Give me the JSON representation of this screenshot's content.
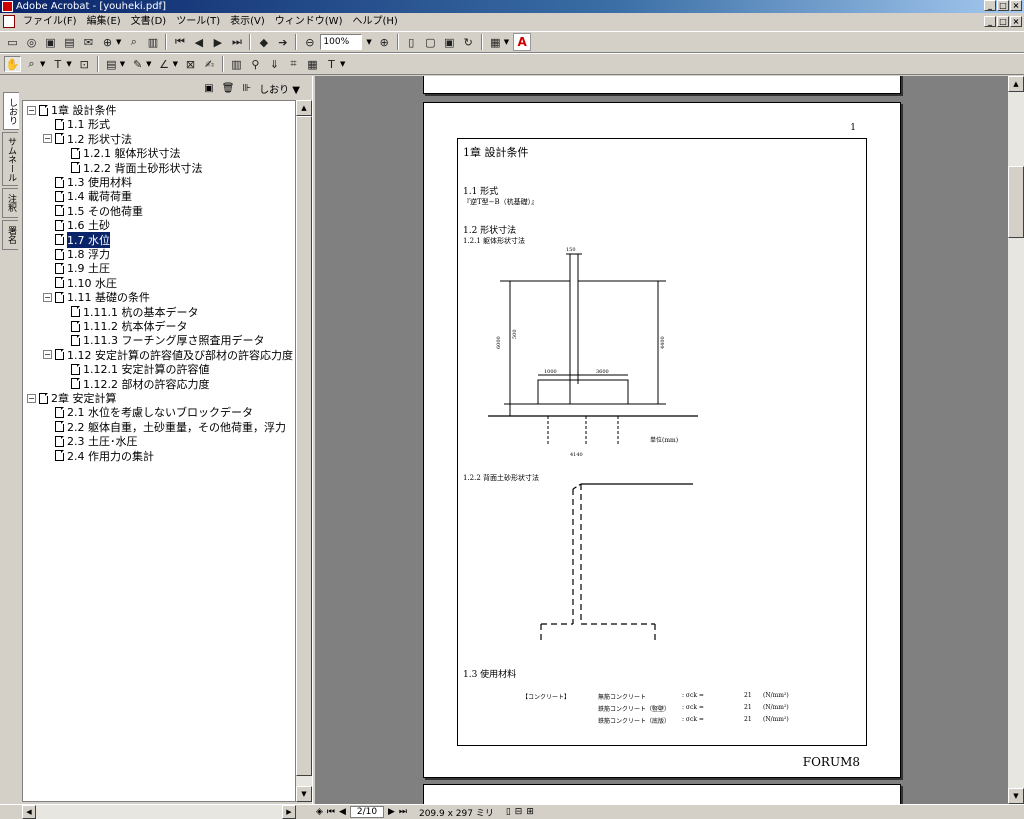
{
  "window": {
    "title": "Adobe Acrobat - [youheki.pdf]"
  },
  "menu": [
    "ファイル(F)",
    "編集(E)",
    "文書(D)",
    "ツール(T)",
    "表示(V)",
    "ウィンドウ(W)",
    "ヘルプ(H)"
  ],
  "toolbar": {
    "zoom": "100%"
  },
  "side_tabs": [
    "しおり",
    "サムネール",
    "注釈",
    "署名"
  ],
  "bookmarks_panel": {
    "title": "しおり"
  },
  "bookmarks": [
    {
      "label": "1章 設計条件",
      "level": 0,
      "toggle": "−"
    },
    {
      "label": "1.1 形式",
      "level": 1
    },
    {
      "label": "1.2 形状寸法",
      "level": 1,
      "toggle": "−"
    },
    {
      "label": "1.2.1 躯体形状寸法",
      "level": 2
    },
    {
      "label": "1.2.2 背面土砂形状寸法",
      "level": 2
    },
    {
      "label": "1.3 使用材料",
      "level": 1
    },
    {
      "label": "1.4 載荷荷重",
      "level": 1
    },
    {
      "label": "1.5 その他荷重",
      "level": 1
    },
    {
      "label": "1.6 土砂",
      "level": 1
    },
    {
      "label": "1.7 水位",
      "level": 1,
      "selected": true
    },
    {
      "label": "1.8 浮力",
      "level": 1
    },
    {
      "label": "1.9 土圧",
      "level": 1
    },
    {
      "label": "1.10 水圧",
      "level": 1
    },
    {
      "label": "1.11 基礎の条件",
      "level": 1,
      "toggle": "−"
    },
    {
      "label": "1.11.1 杭の基本データ",
      "level": 2
    },
    {
      "label": "1.11.2 杭本体データ",
      "level": 2
    },
    {
      "label": "1.11.3 フーチング厚さ照査用データ",
      "level": 2
    },
    {
      "label": "1.12 安定計算の許容値及び部材の許容応力度",
      "level": 1,
      "toggle": "−"
    },
    {
      "label": "1.12.1 安定計算の許容値",
      "level": 2
    },
    {
      "label": "1.12.2 部材の許容応力度",
      "level": 2
    },
    {
      "label": "2章 安定計算",
      "level": 0,
      "toggle": "−"
    },
    {
      "label": "2.1 水位を考慮しないブロックデータ",
      "level": 1
    },
    {
      "label": "2.2 躯体自重，土砂重量，その他荷重，浮力",
      "level": 1
    },
    {
      "label": "2.3 土圧･水圧",
      "level": 1
    },
    {
      "label": "2.4 作用力の集計",
      "level": 1
    }
  ],
  "status": {
    "page": "2/10",
    "size": "209.9 x 297 ミリ"
  },
  "document_page": {
    "page_number": "1",
    "heading_chapter": "1章 設計条件",
    "sec_1_1": "1.1 形式",
    "sec_1_1_text": "『逆T型−B（杭基礎）』",
    "sec_1_2": "1.2 形状寸法",
    "sec_1_2_1": "1.2.1 躯体形状寸法",
    "sec_1_2_2": "1.2.2 背面土砂形状寸法",
    "sec_1_3": "1.3 使用材料",
    "units_note": "単位(mm)",
    "material_label": "【コンクリート】",
    "materials": [
      {
        "name": "無筋コンクリート",
        "sym": ": σck =",
        "value": "21",
        "unit": "(N/mm²)"
      },
      {
        "name": "鉄筋コンクリート（竪壁）",
        "sym": ": σck =",
        "value": "21",
        "unit": "(N/mm²)"
      },
      {
        "name": "鉄筋コンクリート（底版）",
        "sym": ": σck =",
        "value": "21",
        "unit": "(N/mm²)"
      }
    ],
    "dims": {
      "top": "150",
      "left_total": "6000",
      "right_total": "4400",
      "left_low": "500",
      "base_left": "1000",
      "base_right": "3600",
      "bottom": "4140"
    },
    "footer": "FORUM8"
  }
}
